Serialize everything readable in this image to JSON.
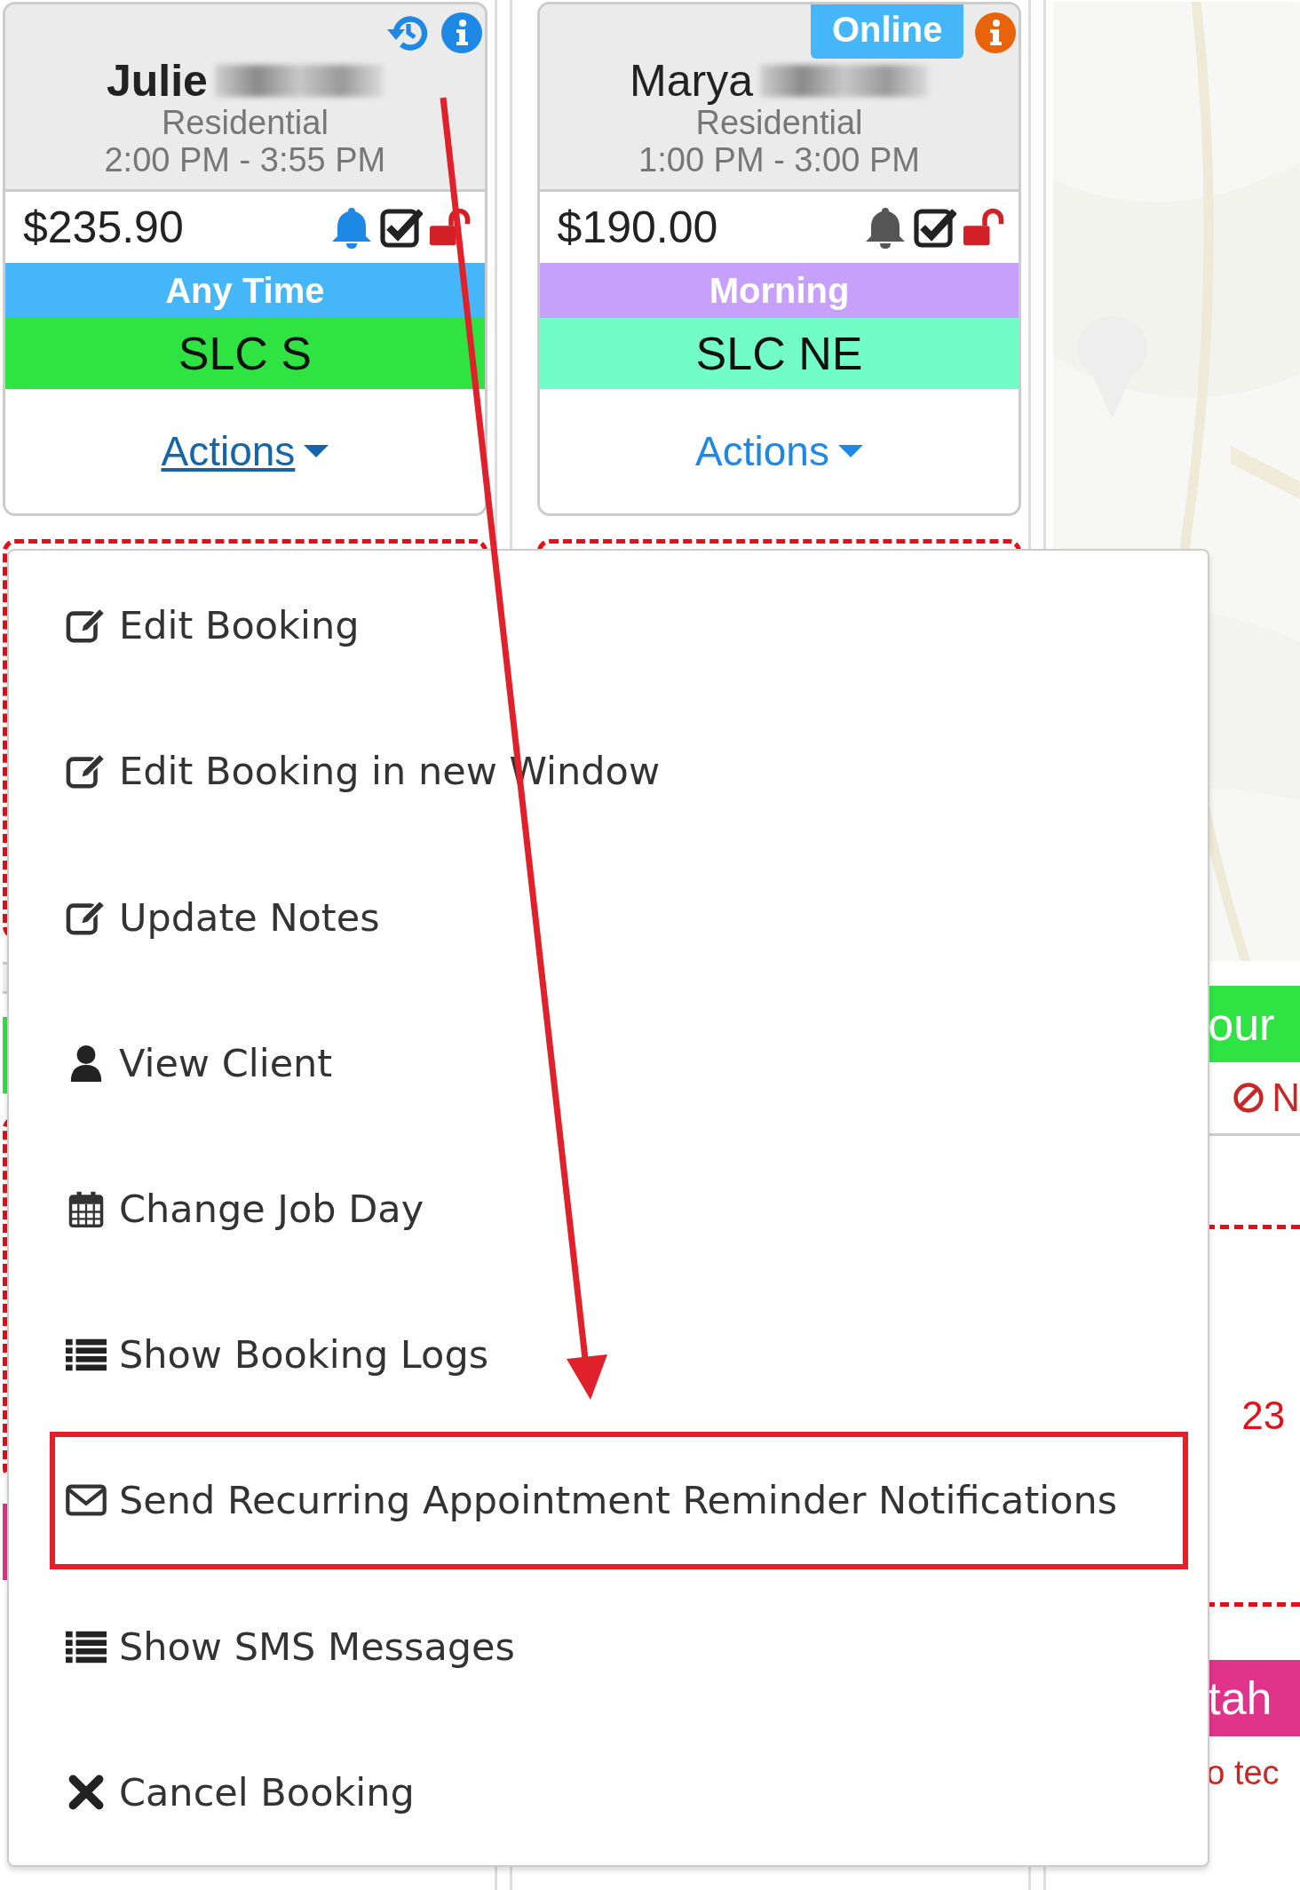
{
  "cards": [
    {
      "name": "Julie",
      "selected": true,
      "header_icons": [
        {
          "kind": "history",
          "color": "#1e88e5"
        },
        {
          "kind": "info",
          "color": "#1e88e5"
        }
      ],
      "category": "Residential",
      "time": "2:00 PM - 3:55 PM",
      "price": "$235.90",
      "reminder_on": true,
      "confirmed": true,
      "locked": false,
      "time_window": {
        "label": "Any Time",
        "color": "#45b6f7"
      },
      "zone": {
        "label": "SLC S",
        "color": "#2ee342"
      },
      "actions": "Actions"
    },
    {
      "name": "Marya",
      "selected": false,
      "badge": "Online",
      "header_icons": [
        {
          "kind": "info",
          "color": "#e8630a"
        }
      ],
      "category": "Residential",
      "time": "1:00 PM - 3:00 PM",
      "price": "$190.00",
      "reminder_on": false,
      "confirmed": true,
      "locked": false,
      "time_window": {
        "label": "Morning",
        "color": "#c7a0fb"
      },
      "zone": {
        "label": "SLC NE",
        "color": "#72fcc8"
      },
      "actions": "Actions"
    }
  ],
  "menu": [
    {
      "kind": "edit",
      "label": "Edit Booking",
      "highlighted": false
    },
    {
      "kind": "edit",
      "label": "Edit Booking in new Window",
      "highlighted": false
    },
    {
      "kind": "edit",
      "label": "Update Notes",
      "highlighted": false
    },
    {
      "kind": "user",
      "label": "View Client",
      "highlighted": false
    },
    {
      "kind": "calendar",
      "label": "Change Job Day",
      "highlighted": false
    },
    {
      "kind": "list",
      "label": "Show Booking Logs",
      "highlighted": false
    },
    {
      "kind": "envelope",
      "label": "Send Recurring Appointment Reminder Notifications",
      "highlighted": true
    },
    {
      "kind": "list",
      "label": "Show SMS Messages",
      "highlighted": false
    },
    {
      "kind": "times",
      "label": "Cancel Booking",
      "highlighted": false
    }
  ],
  "right_column": [
    {
      "kind": "zone_bar",
      "label": "our",
      "color": "#2ee342"
    },
    {
      "kind": "notice",
      "label": "N"
    },
    {
      "kind": "amount",
      "label": "23"
    },
    {
      "kind": "zone_bar",
      "label": "tah",
      "color": "#e0348a"
    },
    {
      "kind": "notice_text",
      "label": "o tec"
    }
  ]
}
